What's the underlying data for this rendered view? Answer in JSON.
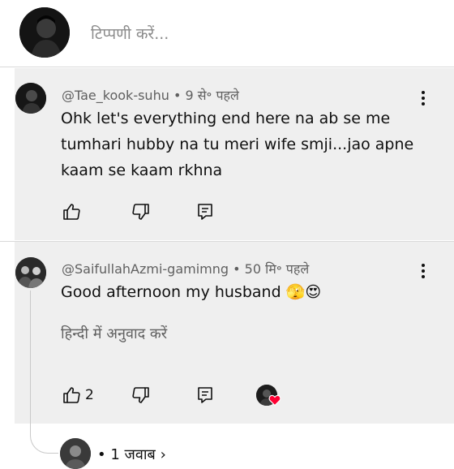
{
  "composer": {
    "placeholder": "टिप्पणी करें..."
  },
  "comments": [
    {
      "author": "@Tae_kook-suhu",
      "time": "9 से॰ पहले",
      "text": "Ohk let's everything end here na ab se me tumhari hubby na tu meri wife smji...jao apne kaam se kaam rkhna",
      "like_count": ""
    },
    {
      "author": "@SaifullahAzmi-gamimng",
      "time": "50 मि॰ पहले",
      "text": "Good afternoon my husband 🫣😍",
      "translate_label": "हिन्दी में अनुवाद करें",
      "like_count": "2"
    }
  ],
  "replies_link": {
    "label": "1 जवाब"
  },
  "separator": "•",
  "icons": [
    "more-vertical-icon",
    "thumb-up-icon",
    "thumb-down-icon",
    "reply-icon",
    "heart-icon",
    "chevron-right-icon"
  ],
  "colors": {
    "card_bg": "#efefef",
    "meta": "#606060",
    "heart": "#ff0033"
  }
}
